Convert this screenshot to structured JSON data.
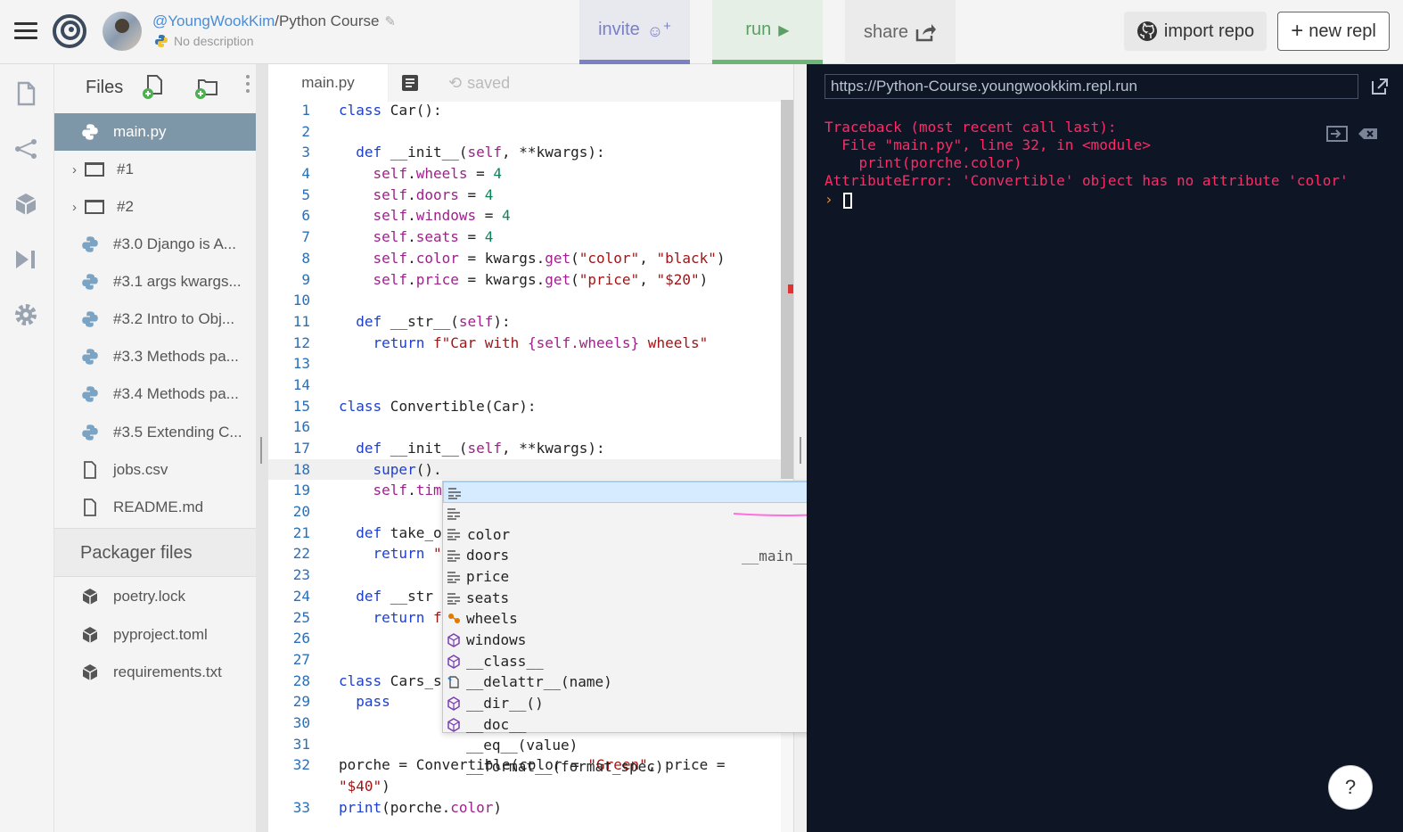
{
  "header": {
    "owner": "@YoungWookKim",
    "separator": "/",
    "project": "Python Course",
    "description": "No description",
    "invite_label": "invite",
    "run_label": "run",
    "share_label": "share",
    "import_label": "import repo",
    "new_repl_label": "new repl"
  },
  "sidebar": {
    "title": "Files",
    "items": [
      {
        "label": "main.py"
      },
      {
        "label": "#1"
      },
      {
        "label": "#2"
      },
      {
        "label": "#3.0 Django is A..."
      },
      {
        "label": "#3.1 args kwargs..."
      },
      {
        "label": "#3.2 Intro to Obj..."
      },
      {
        "label": "#3.3 Methods pa..."
      },
      {
        "label": "#3.4 Methods pa..."
      },
      {
        "label": "#3.5 Extending C..."
      },
      {
        "label": "jobs.csv"
      },
      {
        "label": "README.md"
      }
    ],
    "packager_title": "Packager files",
    "packager_items": [
      {
        "label": "poetry.lock"
      },
      {
        "label": "pyproject.toml"
      },
      {
        "label": "requirements.txt"
      }
    ]
  },
  "editor": {
    "tab_label": "main.py",
    "status": "saved"
  },
  "autocomplete": {
    "detail": "__main__.__init__",
    "items": [
      {
        "label": "color",
        "kind": "field"
      },
      {
        "label": "doors",
        "kind": "field"
      },
      {
        "label": "price",
        "kind": "field"
      },
      {
        "label": "seats",
        "kind": "field"
      },
      {
        "label": "wheels",
        "kind": "field"
      },
      {
        "label": "windows",
        "kind": "field"
      },
      {
        "label": "__class__",
        "kind": "class"
      },
      {
        "label": "__delattr__(name)",
        "kind": "method"
      },
      {
        "label": "__dir__()",
        "kind": "method"
      },
      {
        "label": "__doc__",
        "kind": "property"
      },
      {
        "label": "__eq__(value)",
        "kind": "method"
      },
      {
        "label": "__format__(format_spec)",
        "kind": "method"
      }
    ]
  },
  "console": {
    "url": "https://Python-Course.youngwookkim.repl.run",
    "output": "Traceback (most recent call last):\n  File \"main.py\", line 32, in <module>\n    print(porche.color)\nAttributeError: 'Convertible' object has no attribute 'color'",
    "prompt": "›"
  },
  "help_label": "?",
  "colors": {
    "accent_invite": "#7b7fc4",
    "accent_run": "#6cb676",
    "console_bg": "#0e1525",
    "error_text": "#ff2a66",
    "link_owner": "#4a8dd8"
  }
}
